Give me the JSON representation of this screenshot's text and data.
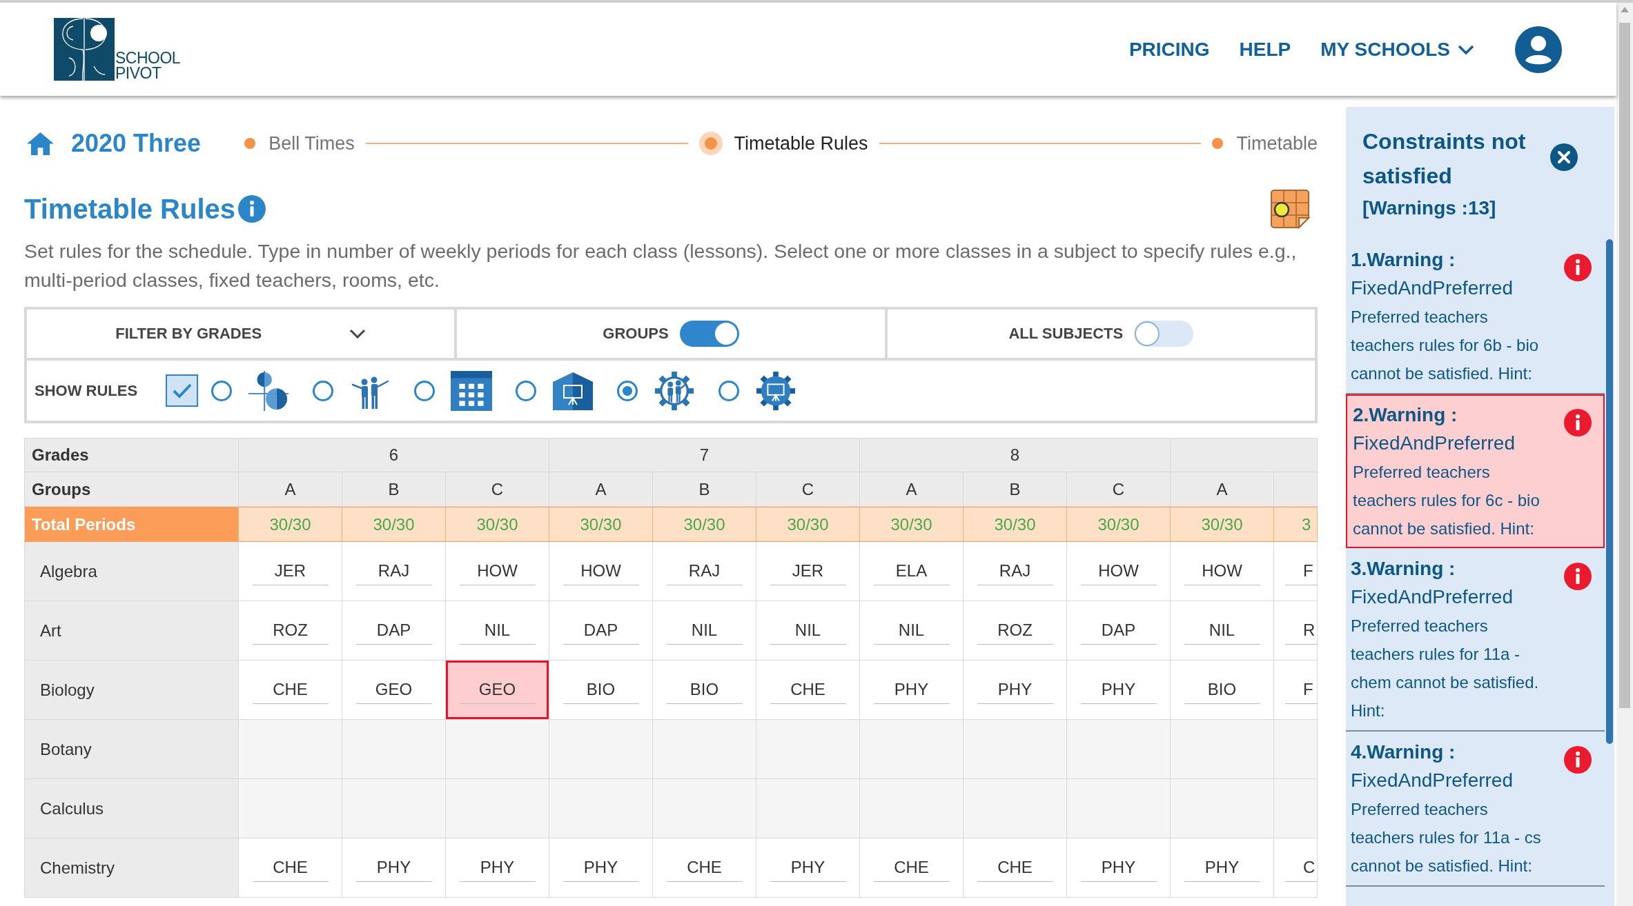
{
  "header": {
    "logo": {
      "lines": [
        "SCHOOL",
        "PIVOT"
      ]
    },
    "nav": [
      {
        "label": "PRICING",
        "kind": "link"
      },
      {
        "label": "HELP",
        "kind": "link"
      },
      {
        "label": "MY SCHOOLS",
        "kind": "dropdown"
      }
    ]
  },
  "breadcrumb": {
    "project": "2020 Three",
    "steps": [
      {
        "label": "Bell Times",
        "selected": false
      },
      {
        "label": "Timetable Rules",
        "selected": true
      },
      {
        "label": "Timetable",
        "selected": false
      }
    ]
  },
  "page": {
    "title": "Timetable Rules",
    "description": "Set rules for the schedule. Type in number of weekly periods for each class (lessons). Select one or more classes in a subject to specify rules e.g., multi-period classes, fixed teachers, rooms, etc."
  },
  "filters": {
    "grade_filter": {
      "label": "FILTER BY GRADES"
    },
    "toggles": [
      {
        "label": "GROUPS",
        "on": true
      },
      {
        "label": "ALL SUBJECTS",
        "on": false
      }
    ]
  },
  "show_rules": {
    "label": "SHOW RULES",
    "checkbox": {
      "checked": true
    },
    "options": [
      {
        "kind": "multi-period",
        "selected": false
      },
      {
        "kind": "teachers",
        "selected": false
      },
      {
        "kind": "periods",
        "selected": false
      },
      {
        "kind": "rooms",
        "selected": false
      },
      {
        "kind": "teacher-constraints",
        "selected": true
      },
      {
        "kind": "room-constraints",
        "selected": false
      }
    ]
  },
  "table": {
    "row_labels": [
      "Grades",
      "Groups",
      "Total Periods"
    ],
    "grades": [
      {
        "label": "6",
        "groups": [
          {
            "label": "A",
            "total": "30/30"
          },
          {
            "label": "B",
            "total": "30/30"
          },
          {
            "label": "C",
            "total": "30/30"
          }
        ]
      },
      {
        "label": "7",
        "groups": [
          {
            "label": "A",
            "total": "30/30"
          },
          {
            "label": "B",
            "total": "30/30"
          },
          {
            "label": "C",
            "total": "30/30"
          }
        ]
      },
      {
        "label": "8",
        "groups": [
          {
            "label": "A",
            "total": "30/30"
          },
          {
            "label": "B",
            "total": "30/30"
          },
          {
            "label": "C",
            "total": "30/30"
          }
        ]
      },
      {
        "groups": [
          {
            "label": "A",
            "total": "30/30"
          },
          {
            "total": "3"
          }
        ]
      }
    ],
    "rows": [
      {
        "subject": "Algebra",
        "disabled": false,
        "cells": [
          {
            "value": "JER",
            "highlighted": false
          },
          {
            "value": "RAJ",
            "highlighted": false
          },
          {
            "value": "HOW",
            "highlighted": false
          },
          {
            "value": "HOW",
            "highlighted": false
          },
          {
            "value": "RAJ",
            "highlighted": false
          },
          {
            "value": "JER",
            "highlighted": false
          },
          {
            "value": "ELA",
            "highlighted": false
          },
          {
            "value": "RAJ",
            "highlighted": false
          },
          {
            "value": "HOW",
            "highlighted": false
          },
          {
            "value": "HOW",
            "highlighted": false
          },
          {
            "value": "F",
            "highlighted": false
          }
        ]
      },
      {
        "subject": "Art",
        "disabled": false,
        "cells": [
          {
            "value": "ROZ",
            "highlighted": false
          },
          {
            "value": "DAP",
            "highlighted": false
          },
          {
            "value": "NIL",
            "highlighted": false
          },
          {
            "value": "DAP",
            "highlighted": false
          },
          {
            "value": "NIL",
            "highlighted": false
          },
          {
            "value": "NIL",
            "highlighted": false
          },
          {
            "value": "NIL",
            "highlighted": false
          },
          {
            "value": "ROZ",
            "highlighted": false
          },
          {
            "value": "DAP",
            "highlighted": false
          },
          {
            "value": "NIL",
            "highlighted": false
          },
          {
            "value": "R",
            "highlighted": false
          }
        ]
      },
      {
        "subject": "Biology",
        "disabled": false,
        "cells": [
          {
            "value": "CHE",
            "highlighted": false
          },
          {
            "value": "GEO",
            "highlighted": false
          },
          {
            "value": "GEO",
            "highlighted": true
          },
          {
            "value": "BIO",
            "highlighted": false
          },
          {
            "value": "BIO",
            "highlighted": false
          },
          {
            "value": "CHE",
            "highlighted": false
          },
          {
            "value": "PHY",
            "highlighted": false
          },
          {
            "value": "PHY",
            "highlighted": false
          },
          {
            "value": "PHY",
            "highlighted": false
          },
          {
            "value": "BIO",
            "highlighted": false
          },
          {
            "value": "F",
            "highlighted": false
          }
        ]
      },
      {
        "subject": "Botany",
        "disabled": true
      },
      {
        "subject": "Calculus",
        "disabled": true
      },
      {
        "subject": "Chemistry",
        "disabled": false,
        "cells": [
          {
            "value": "CHE",
            "highlighted": false
          },
          {
            "value": "PHY",
            "highlighted": false
          },
          {
            "value": "PHY",
            "highlighted": false
          },
          {
            "value": "PHY",
            "highlighted": false
          },
          {
            "value": "CHE",
            "highlighted": false
          },
          {
            "value": "PHY",
            "highlighted": false
          },
          {
            "value": "CHE",
            "highlighted": false
          },
          {
            "value": "CHE",
            "highlighted": false
          },
          {
            "value": "PHY",
            "highlighted": false
          },
          {
            "value": "PHY",
            "highlighted": false
          },
          {
            "value": "C",
            "highlighted": false
          }
        ]
      }
    ]
  },
  "constraints_panel": {
    "title": "Constraints not satisfied",
    "count": "[Warnings :13]",
    "warnings": [
      {
        "heading": "1.Warning :",
        "type": "FixedAndPreferred",
        "message": "Preferred teachers teachers rules for 6b - bio cannot be satisfied. Hint:",
        "selected": false
      },
      {
        "heading": "2.Warning :",
        "type": "FixedAndPreferred",
        "message": "Preferred teachers teachers rules for 6c - bio cannot be satisfied. Hint:",
        "selected": true
      },
      {
        "heading": "3.Warning :",
        "type": "FixedAndPreferred",
        "message": "Preferred teachers teachers rules for 11a - chem cannot be satisfied. Hint:",
        "selected": false
      },
      {
        "heading": "4.Warning :",
        "type": "FixedAndPreferred",
        "message": "Preferred teachers teachers rules for 11a - cs cannot be satisfied. Hint:",
        "selected": false
      }
    ]
  }
}
